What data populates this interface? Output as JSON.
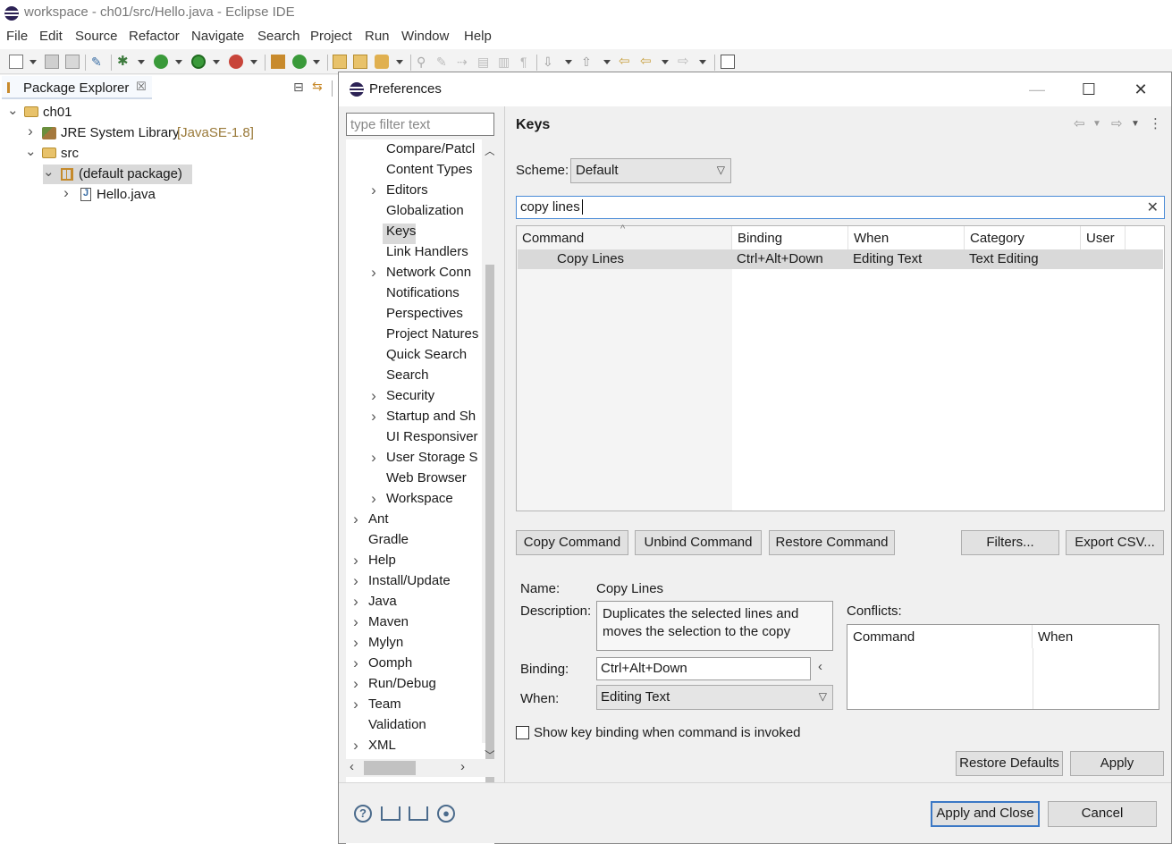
{
  "window": {
    "title": "workspace - ch01/src/Hello.java - Eclipse IDE"
  },
  "menu": [
    "File",
    "Edit",
    "Source",
    "Refactor",
    "Navigate",
    "Search",
    "Project",
    "Run",
    "Window",
    "Help"
  ],
  "package_explorer": {
    "tab_label": "Package Explorer",
    "tree": {
      "project": "ch01",
      "jre": "JRE System Library",
      "jre_version": "[JavaSE-1.8]",
      "src": "src",
      "package": "(default package)",
      "file": "Hello.java"
    }
  },
  "dialog": {
    "title": "Preferences",
    "filter_placeholder": "type filter text",
    "tree_items": [
      "Compare/Patcl",
      "Content Types",
      "Editors",
      "Globalization",
      "Keys",
      "Link Handlers",
      "Network Conn",
      "Notifications",
      "Perspectives",
      "Project Natures",
      "Quick Search",
      "Search",
      "Security",
      "Startup and Sh",
      "UI Responsiver",
      "User Storage S",
      "Web Browser",
      "Workspace",
      "Ant",
      "Gradle",
      "Help",
      "Install/Update",
      "Java",
      "Maven",
      "Mylyn",
      "Oomph",
      "Run/Debug",
      "Team",
      "Validation",
      "XML"
    ],
    "selected_tree_item": "Keys",
    "page_title": "Keys",
    "scheme_label": "Scheme:",
    "scheme_value": "Default",
    "search_value": "copy lines",
    "table_headers": [
      "Command",
      "Binding",
      "When",
      "Category",
      "User"
    ],
    "rows": [
      {
        "command": "Copy Lines",
        "binding": "Ctrl+Alt+Down",
        "when": "Editing Text",
        "category": "Text Editing",
        "user": ""
      }
    ],
    "buttons": {
      "copy_command": "Copy Command",
      "unbind_command": "Unbind Command",
      "restore_command": "Restore Command",
      "filters": "Filters...",
      "export_csv": "Export CSV...",
      "restore_defaults": "Restore Defaults",
      "apply": "Apply",
      "apply_and_close": "Apply and Close",
      "cancel": "Cancel"
    },
    "details": {
      "name_label": "Name:",
      "name_value": "Copy Lines",
      "description_label": "Description:",
      "description_value": "Duplicates the selected lines and moves the selection to the copy",
      "binding_label": "Binding:",
      "binding_value": "Ctrl+Alt+Down",
      "when_label": "When:",
      "when_value": "Editing Text",
      "conflicts_label": "Conflicts:",
      "conflicts_headers": [
        "Command",
        "When"
      ],
      "checkbox_label": "Show key binding when command is invoked",
      "checkbox_checked": false
    }
  }
}
